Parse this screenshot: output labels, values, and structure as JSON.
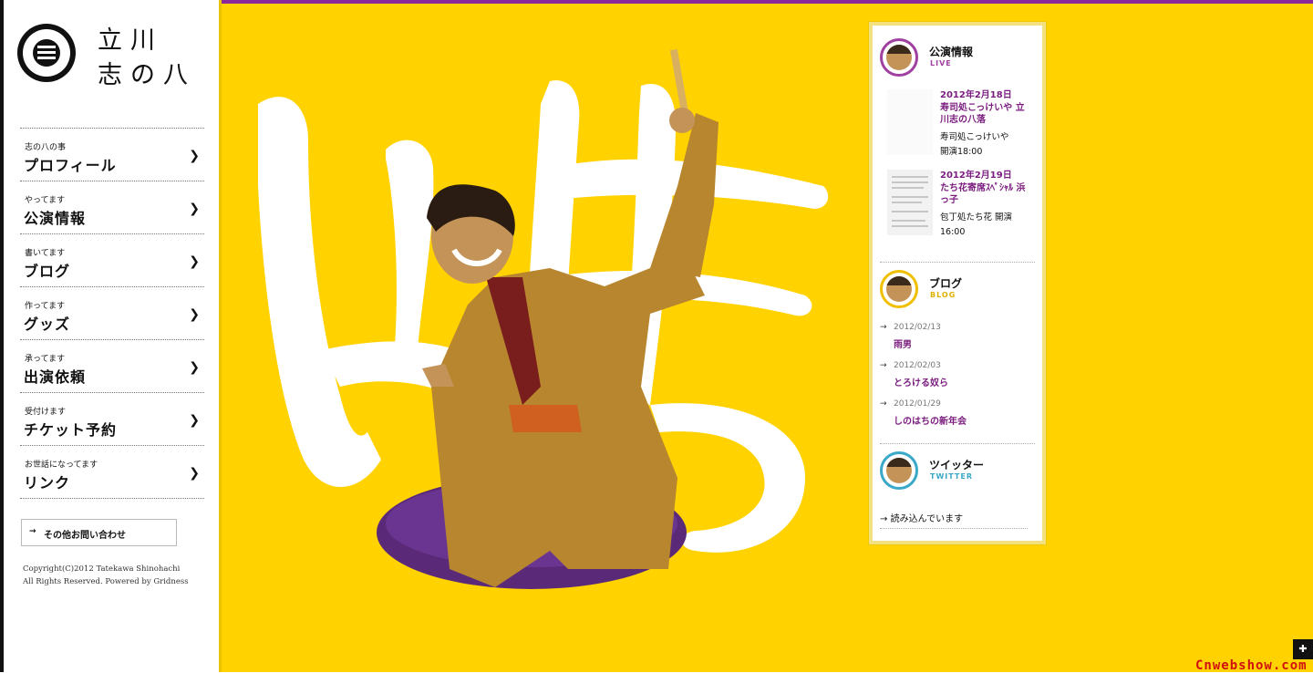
{
  "logo": {
    "line1": "立川",
    "line2": "志の八"
  },
  "nav": [
    {
      "sub": "志の八の事",
      "label": "プロフィール"
    },
    {
      "sub": "やってます",
      "label": "公演情報"
    },
    {
      "sub": "書いてます",
      "label": "ブログ"
    },
    {
      "sub": "作ってます",
      "label": "グッズ"
    },
    {
      "sub": "承ってます",
      "label": "出演依頼"
    },
    {
      "sub": "受付けます",
      "label": "チケット予約"
    },
    {
      "sub": "お世話になってます",
      "label": "リンク"
    }
  ],
  "contact": {
    "label": "その他お問い合わせ"
  },
  "copyright": {
    "line1": "Copyright(C)2012 Tatekawa Shinohachi",
    "line2": "All Rights Reserved.  Powered by Gridness"
  },
  "live": {
    "title": "公演情報",
    "en": "LIVE",
    "items": [
      {
        "title": "2012年2月18日\n寿司処こっけいや 立川志の八落",
        "desc": "寿司処こっけいや\n開演18:00"
      },
      {
        "title": "2012年2月19日\nたち花寄席ｽﾍﾟｼｬﾙ 浜っ子",
        "desc": "包丁処たち花 開演16:00"
      }
    ]
  },
  "blog": {
    "title": "ブログ",
    "en": "BLOG",
    "items": [
      {
        "date": "2012/02/13",
        "title": "雨男"
      },
      {
        "date": "2012/02/03",
        "title": "とろける奴ら"
      },
      {
        "date": "2012/01/29",
        "title": "しのはちの新年会"
      }
    ]
  },
  "twitter": {
    "title": "ツイッター",
    "en": "TWITTER",
    "loading": "読み込んでいます"
  },
  "watermark": "Cnwebshow.com",
  "colors": {
    "accent": "#7a1d7f",
    "background": "#ffd200",
    "live": "#a040a0",
    "blog": "#f0c000",
    "twitter": "#3aa8c8"
  },
  "icons": {
    "nav_arrow": "chevron-right-icon",
    "contact_arrow": "arrow-right-icon",
    "corner": "expand-icon"
  }
}
